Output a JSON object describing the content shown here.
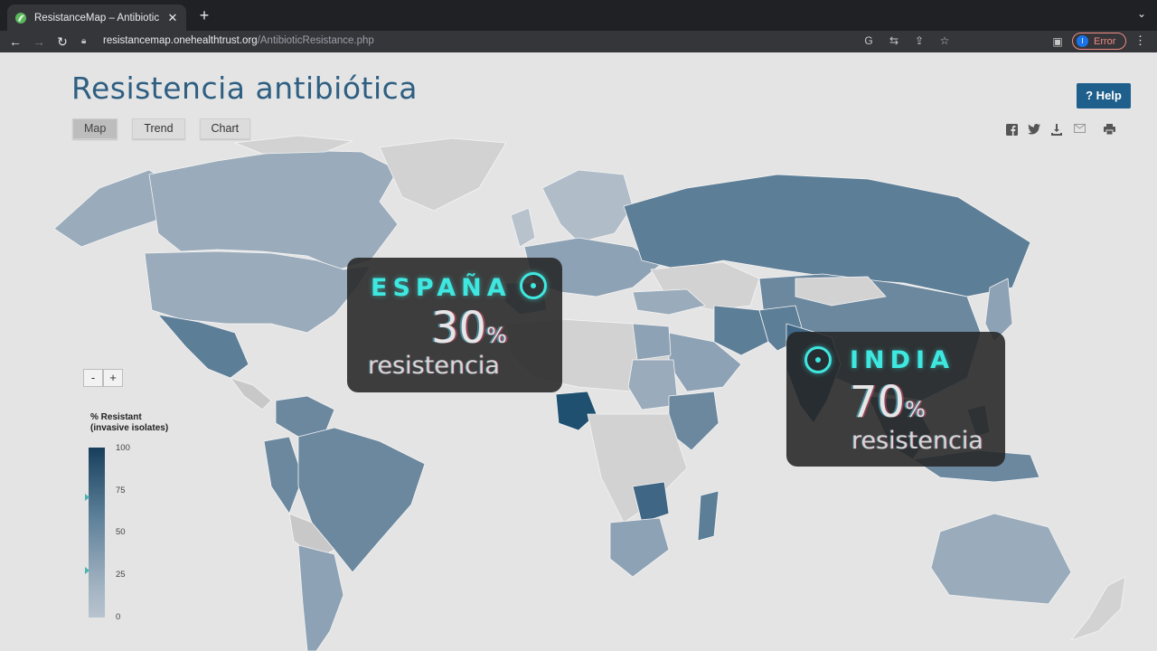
{
  "browser": {
    "tab_title": "ResistanceMap – Antibiotic Re",
    "url_host": "resistancemap.onehealthtrust.org",
    "url_path": "/AntibioticResistance.php",
    "profile_initial": "I",
    "profile_label": "Error"
  },
  "page": {
    "title": "Resistencia antibiótica",
    "help_label": "? Help",
    "view_tabs": [
      {
        "label": "Map",
        "active": true
      },
      {
        "label": "Trend",
        "active": false
      },
      {
        "label": "Chart",
        "active": false
      }
    ]
  },
  "map": {
    "zoom_out": "-",
    "zoom_in": "+",
    "legend": {
      "title_line1": "% Resistant",
      "title_line2": "(invasive isolates)",
      "ticks": [
        "100",
        "75",
        "50",
        "25",
        "0"
      ],
      "color_high": "#173f5c",
      "color_low": "#b8c4cf"
    }
  },
  "overlays": {
    "spain": {
      "country": "ESPAÑA",
      "percent": "30",
      "percent_sign": "%",
      "label": "resistencia"
    },
    "india": {
      "country": "INDIA",
      "percent": "70",
      "percent_sign": "%",
      "label": "resistencia"
    },
    "accent_color": "#3ee8e0"
  },
  "icons": {
    "share": [
      "facebook-icon",
      "twitter-icon",
      "download-icon",
      "email-icon",
      "print-icon"
    ]
  }
}
